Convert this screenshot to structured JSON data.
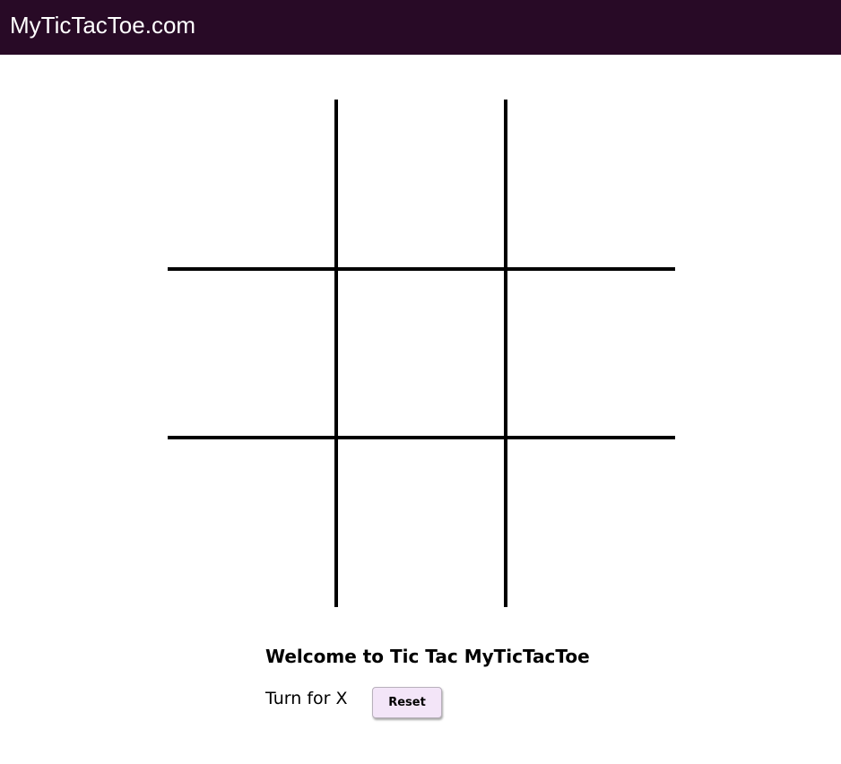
{
  "navbar": {
    "brand": "MyTicTacToe.com",
    "background": "#280a26"
  },
  "board": {
    "cells": [
      "",
      "",
      "",
      "",
      "",
      "",
      "",
      "",
      ""
    ]
  },
  "status": {
    "welcome": "Welcome to Tic Tac MyTicTacToe",
    "turn": "Turn for X",
    "reset_label": "Reset",
    "reset_color": "#f3e5f8"
  }
}
